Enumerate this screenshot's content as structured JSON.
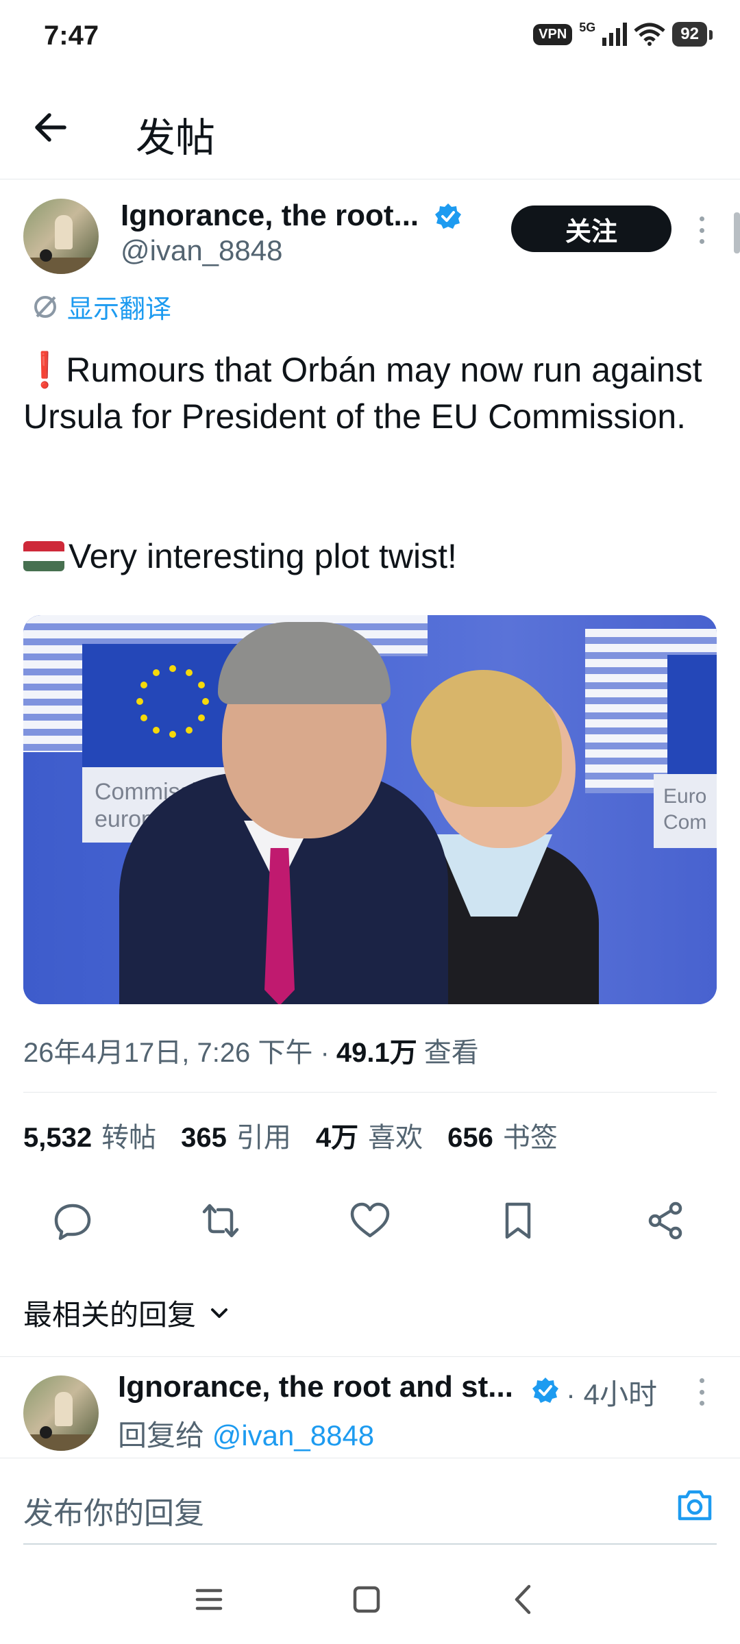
{
  "status_bar": {
    "time": "7:47",
    "vpn": "VPN",
    "network": "5G",
    "battery": "92"
  },
  "header": {
    "title": "发帖"
  },
  "post": {
    "author_name": "Ignorance, the root...",
    "author_handle": "@ivan_8848",
    "follow_label": "关注",
    "translate_label": "显示翻译",
    "text_line1": "Rumours that Orbán may now run against Ursula for President of the EU Commission.",
    "text_line2": "Very interesting plot twist!",
    "media_caption": "Commission européenne",
    "media_caption_right": "Euro Com",
    "timestamp": "26年4月17日, 7:26 下午 ·",
    "views_count": "49.1万",
    "views_label": "查看"
  },
  "stats": [
    {
      "count": "5,532",
      "label": "转帖"
    },
    {
      "count": "365",
      "label": "引用"
    },
    {
      "count": "4万",
      "label": "喜欢"
    },
    {
      "count": "656",
      "label": "书签"
    }
  ],
  "replies": {
    "sort_label": "最相关的回复",
    "first_reply": {
      "author_name": "Ignorance, the root and st...",
      "time": "· 4小时",
      "reply_to_prefix": "回复给",
      "reply_to_handle": "@ivan_8848"
    }
  },
  "composer": {
    "placeholder": "发布你的回复"
  },
  "colors": {
    "accent": "#1d9bf0",
    "text_primary": "#0f1419",
    "text_secondary": "#536471",
    "follow_button": "#0f1419"
  }
}
